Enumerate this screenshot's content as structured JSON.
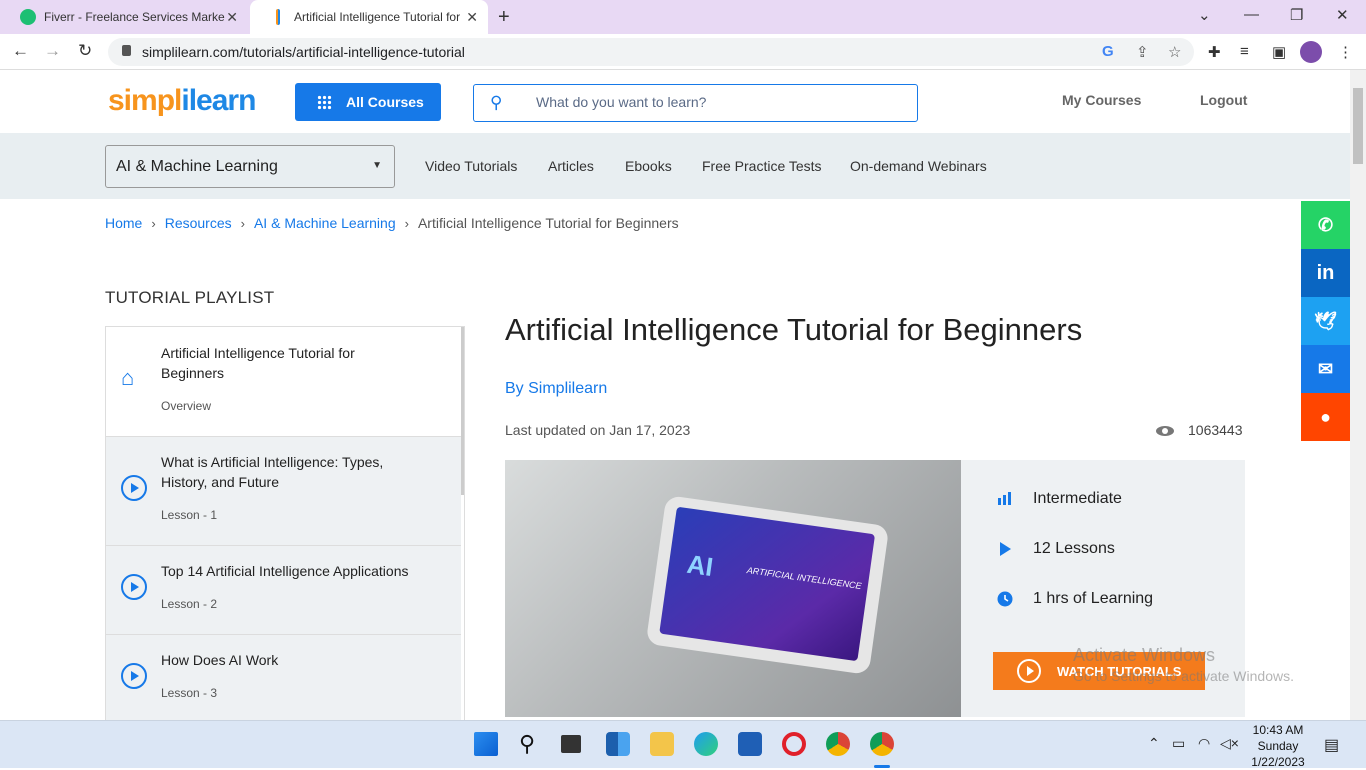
{
  "browser": {
    "tabs": [
      {
        "title": "Fiverr - Freelance Services Marke",
        "active": false
      },
      {
        "title": "Artificial Intelligence Tutorial for",
        "active": true
      }
    ],
    "url": "simplilearn.com/tutorials/artificial-intelligence-tutorial"
  },
  "header": {
    "logo_part1": "simpl",
    "logo_part2": "ilearn",
    "all_courses": "All Courses",
    "search_placeholder": "What do you want to learn?",
    "my_courses": "My Courses",
    "logout": "Logout"
  },
  "subnav": {
    "category": "AI & Machine Learning",
    "links": [
      "Video Tutorials",
      "Articles",
      "Ebooks",
      "Free Practice Tests",
      "On-demand Webinars"
    ]
  },
  "breadcrumb": [
    "Home",
    "Resources",
    "AI & Machine Learning",
    "Artificial Intelligence Tutorial for Beginners"
  ],
  "share": [
    "whatsapp-icon",
    "linkedin-icon",
    "twitter-icon",
    "messenger-icon",
    "reddit-icon"
  ],
  "playlist": {
    "heading": "TUTORIAL PLAYLIST",
    "items": [
      {
        "title": "Artificial Intelligence Tutorial for Beginners",
        "sub": "Overview"
      },
      {
        "title": "What is Artificial Intelligence: Types, History, and Future",
        "sub": "Lesson - 1"
      },
      {
        "title": "Top 14 Artificial Intelligence Applications",
        "sub": "Lesson - 2"
      },
      {
        "title": "How Does AI Work",
        "sub": "Lesson - 3"
      }
    ]
  },
  "main": {
    "title": "Artificial Intelligence Tutorial for Beginners",
    "author": "By Simplilearn",
    "updated": "Last updated on Jan 17, 2023",
    "views": "1063443",
    "hero_ai": "AI",
    "hero_text": "ARTIFICIAL INTELLIGENCE",
    "level": "Intermediate",
    "lessons": "12 Lessons",
    "duration": "1 hrs of Learning",
    "watch": "WATCH TUTORIALS"
  },
  "watermark": {
    "line1": "Activate Windows",
    "line2": "Go to Settings to activate Windows."
  },
  "taskbar": {
    "time": "10:43 AM",
    "day": "Sunday",
    "date": "1/22/2023"
  },
  "colors": {
    "accent": "#1679e8",
    "orange": "#f47b1c",
    "whatsapp": "#25d366",
    "linkedin": "#0a66c2",
    "twitter": "#1da1f2",
    "messenger": "#1679e8",
    "reddit": "#ff4500"
  }
}
